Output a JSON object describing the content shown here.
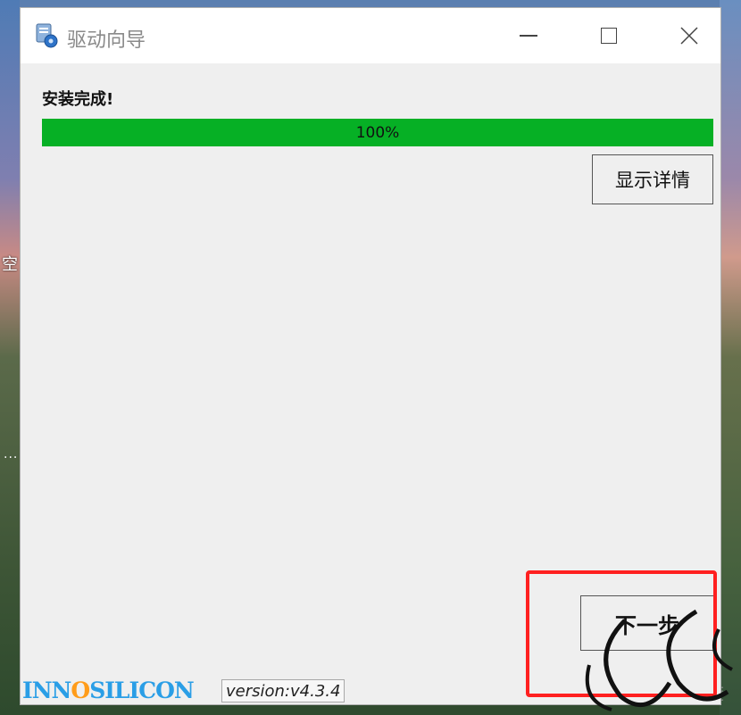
{
  "desktop": {
    "side_char": "空",
    "side_dots": "···"
  },
  "window": {
    "title": "驱动向导",
    "icon": "driver-wizard-icon",
    "controls": {
      "minimize_icon": "minimize-icon",
      "maximize_icon": "maximize-icon",
      "close_icon": "close-icon"
    }
  },
  "content": {
    "status_title": "安装完成!",
    "progress": {
      "percent": 100,
      "text": "100%",
      "fill_color": "#06b025"
    },
    "details_button": "显示详情",
    "next_button": "下一步"
  },
  "footer": {
    "brand_prefix": "INN",
    "brand_o": "O",
    "brand_suffix": "SILICON",
    "version": "version:v4.3.4"
  },
  "colors": {
    "highlight": "#ff2020",
    "brand_blue": "#2a9ee6",
    "brand_orange": "#ff9c1a"
  }
}
